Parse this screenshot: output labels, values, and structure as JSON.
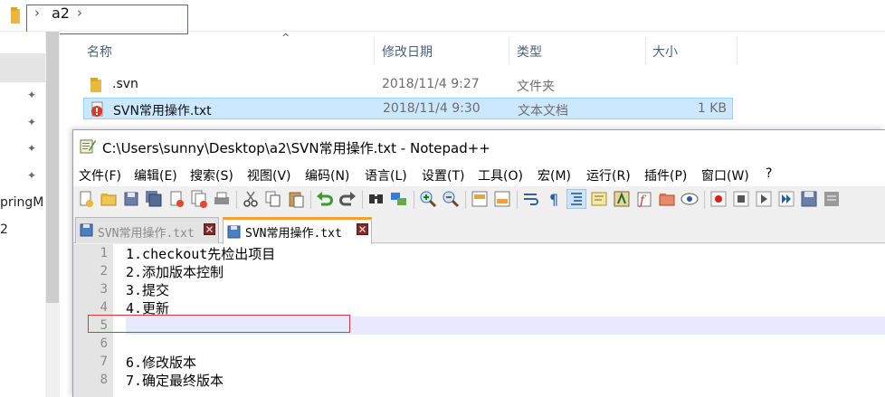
{
  "explorer": {
    "breadcrumb": {
      "current": "a2",
      "chevron": "›"
    },
    "left_pane": {
      "truncated_items": [
        "pringM",
        "2"
      ],
      "pin_icons": 4
    },
    "columns": {
      "name": "名称",
      "date_modified": "修改日期",
      "type": "类型",
      "size": "大小",
      "sort_indicator": "^"
    },
    "files": [
      {
        "name": ".svn",
        "date": "2018/11/4 9:27",
        "type": "文件夹",
        "size": "",
        "icon": "folder-icon",
        "selected": false
      },
      {
        "name": "SVN常用操作.txt",
        "date": "2018/11/4 9:30",
        "type": "文本文档",
        "size": "1 KB",
        "icon": "svn-conflict-icon",
        "selected": true
      }
    ]
  },
  "notepad": {
    "title": "C:\\Users\\sunny\\Desktop\\a2\\SVN常用操作.txt - Notepad++",
    "menu": [
      "文件(F)",
      "编辑(E)",
      "搜索(S)",
      "视图(V)",
      "编码(N)",
      "语言(L)",
      "设置(T)",
      "工具(O)",
      "宏(M)",
      "运行(R)",
      "插件(P)",
      "窗口(W)",
      "?"
    ],
    "tabs": [
      {
        "label": "SVN常用操作.txt",
        "active": false
      },
      {
        "label": "SVN常用操作.txt",
        "active": true
      }
    ],
    "lines": [
      {
        "num": "1",
        "text": "1.checkout先检出项目"
      },
      {
        "num": "2",
        "text": "2.添加版本控制"
      },
      {
        "num": "3",
        "text": "3.提交"
      },
      {
        "num": "4",
        "text": "4.更新"
      },
      {
        "num": "5",
        "text": ""
      },
      {
        "num": "6",
        "text": ""
      },
      {
        "num": "7",
        "text": "6.修改版本"
      },
      {
        "num": "8",
        "text": "7.确定最终版本"
      }
    ],
    "current_line": "5"
  },
  "colors": {
    "selection_blue": "#cce8ff",
    "annotation_red": "#e0333b",
    "active_tab_accent": "#f7a12d",
    "current_line_bg": "#e8e8ff"
  }
}
